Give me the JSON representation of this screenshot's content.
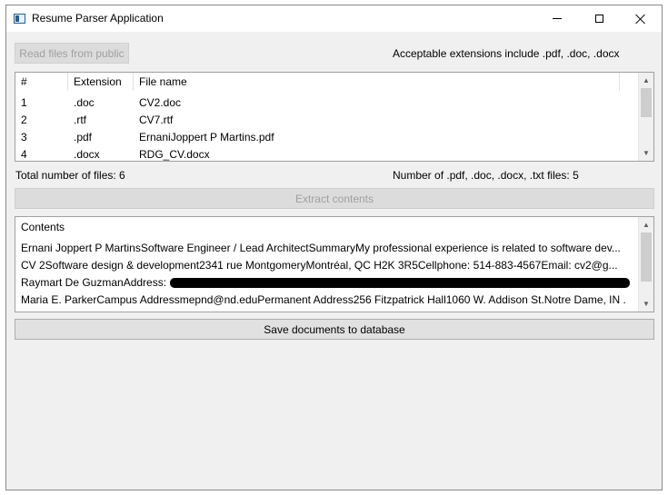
{
  "window": {
    "title": "Resume Parser Application"
  },
  "toolbar": {
    "read_files_label": "Read files from public",
    "extensions_note": "Acceptable extensions include .pdf, .doc, .docx"
  },
  "files_table": {
    "columns": [
      "#",
      "Extension",
      "File name"
    ],
    "rows": [
      {
        "num": "1",
        "ext": ".doc",
        "name": "CV2.doc"
      },
      {
        "num": "2",
        "ext": ".rtf",
        "name": "CV7.rtf"
      },
      {
        "num": "3",
        "ext": ".pdf",
        "name": "ErnaniJoppert P Martins.pdf"
      },
      {
        "num": "4",
        "ext": ".docx",
        "name": "RDG_CV.docx"
      }
    ]
  },
  "stats": {
    "total_files": "Total number of files: 6",
    "supported_files": "Number of .pdf, .doc, .docx, .txt files: 5"
  },
  "extract_button_label": "Extract contents",
  "contents_table": {
    "header": "Contents",
    "rows": [
      "Ernani Joppert P MartinsSoftware Engineer / Lead ArchitectSummaryMy professional experience is related to software dev...",
      " CV 2Software design & development2341 rue MontgomeryMontréal, QC H2K 3R5Cellphone: 514-883-4567Email: cv2@g...",
      "Raymart De GuzmanAddress:",
      "Maria E. ParkerCampus Addressmepnd@nd.eduPermanent Address256 Fitzpatrick Hall1060 W. Addison St.Notre Dame, IN ..."
    ]
  },
  "save_button_label": "Save documents to database",
  "icons": {
    "app": "app-window-icon",
    "minimize": "minimize-icon",
    "maximize": "maximize-icon",
    "close": "close-icon",
    "scroll_up": "chevron-up-icon",
    "scroll_down": "chevron-down-icon"
  }
}
